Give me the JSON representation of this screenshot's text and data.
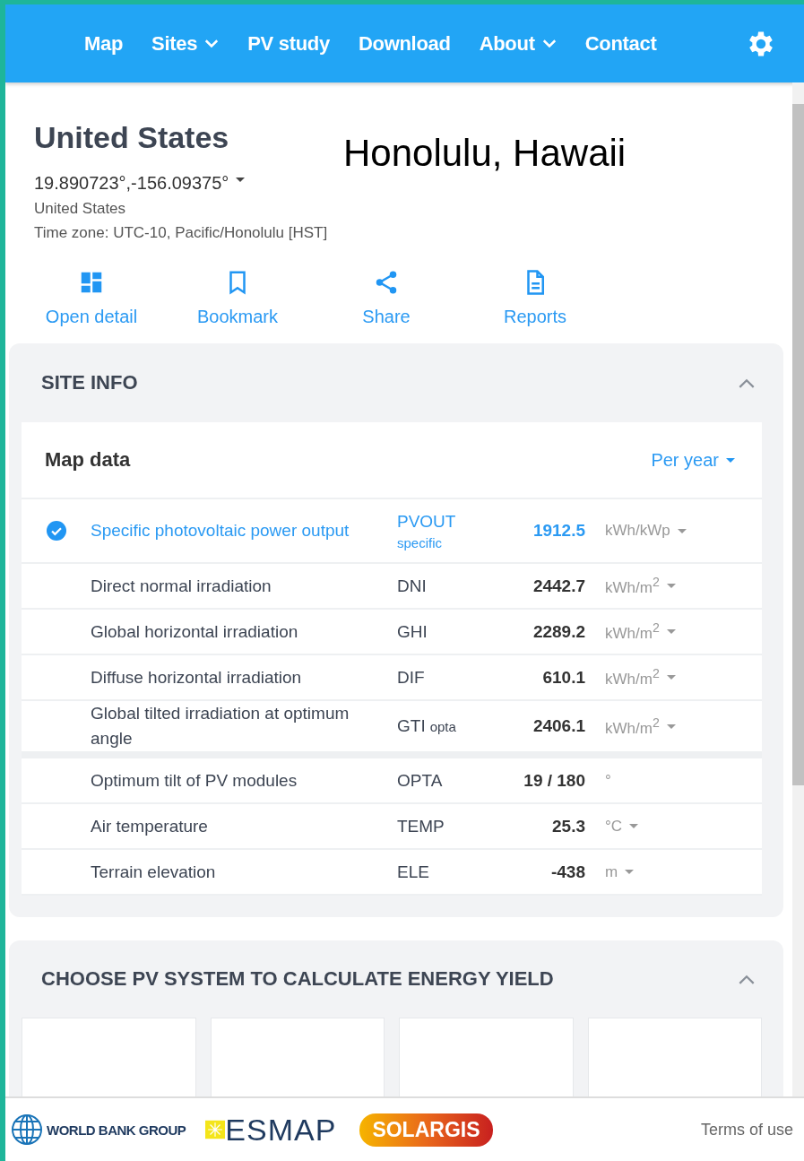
{
  "nav": [
    {
      "label": "Map",
      "dropdown": false
    },
    {
      "label": "Sites",
      "dropdown": true
    },
    {
      "label": "PV study",
      "dropdown": false
    },
    {
      "label": "Download",
      "dropdown": false
    },
    {
      "label": "About",
      "dropdown": true
    },
    {
      "label": "Contact",
      "dropdown": false
    }
  ],
  "site": {
    "title": "United States",
    "overlay_label": "Honolulu, Hawaii",
    "coordinates": "19.890723°,-156.09375°",
    "country": "United States",
    "timezone": "Time zone: UTC-10, Pacific/Honolulu [HST]"
  },
  "actions": [
    "Open detail",
    "Bookmark",
    "Share",
    "Reports"
  ],
  "site_info": {
    "title": "SITE INFO",
    "expanded": true,
    "card_title": "Map data",
    "period": "Per year",
    "groups": [
      [
        {
          "name": "Specific photovoltaic power output",
          "code": "PVOUT",
          "code_note": "specific",
          "value": "1912.5",
          "unit": "kWh/kWp",
          "dropdown": true,
          "checked": true
        },
        {
          "name": "Direct normal irradiation",
          "code": "DNI",
          "value": "2442.7",
          "unit": "kWh/m$^{2}$",
          "dropdown": true,
          "checked": false
        },
        {
          "name": "Global horizontal irradiation",
          "code": "GHI",
          "value": "2289.2",
          "unit": "kWh/m$^{2}$",
          "dropdown": true,
          "checked": false
        },
        {
          "name": "Diffuse horizontal irradiation",
          "code": "DIF",
          "value": "610.1",
          "unit": "kWh/m$^{2}$",
          "dropdown": true,
          "checked": false
        },
        {
          "name": "Global tilted irradiation at optimum angle",
          "code": "GTI",
          "code_note": "opta",
          "value": "2406.1",
          "unit": "kWh/m$^{2}$",
          "dropdown": true,
          "checked": false
        }
      ],
      [
        {
          "name": "Optimum tilt of PV modules",
          "code": "OPTA",
          "value": "19 /  180",
          "unit": "°",
          "dropdown": false,
          "checked": false
        },
        {
          "name": "Air temperature",
          "code": "TEMP",
          "value": "25.3",
          "unit": "°C",
          "dropdown": true,
          "checked": false
        },
        {
          "name": "Terrain elevation",
          "code": "ELE",
          "value": "-438",
          "unit": "m",
          "dropdown": true,
          "checked": false
        }
      ]
    ]
  },
  "pv_system": {
    "title": "CHOOSE PV SYSTEM TO CALCULATE ENERGY YIELD",
    "expanded": true
  },
  "footer": {
    "logos": [
      "WORLD BANK GROUP",
      "ESMAP",
      "SOLARGIS"
    ],
    "link": "Terms of use"
  }
}
